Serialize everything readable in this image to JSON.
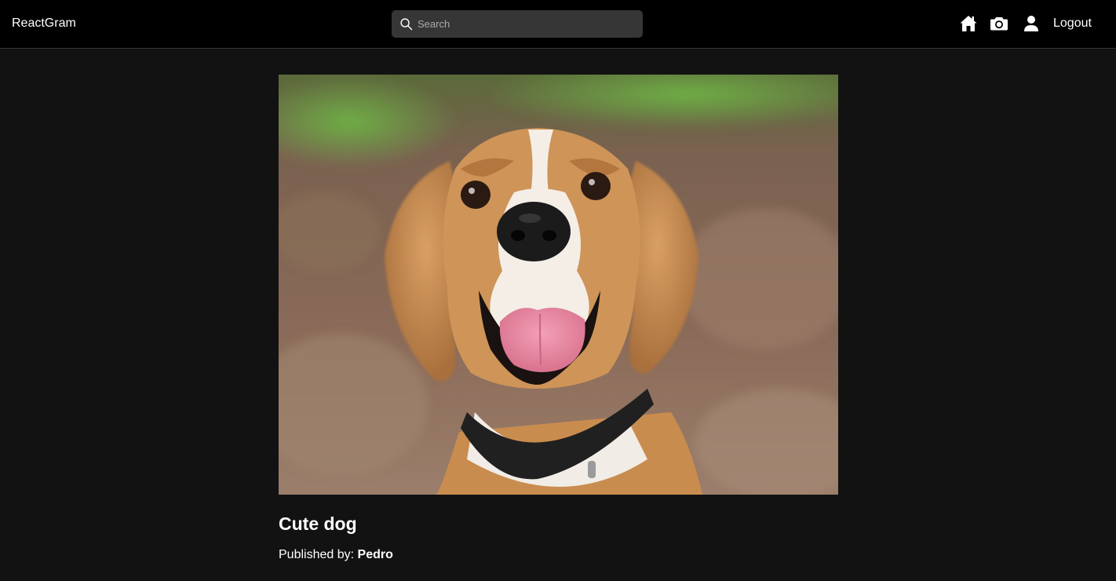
{
  "nav": {
    "brand": "ReactGram",
    "search": {
      "placeholder": "Search",
      "value": ""
    },
    "icons": [
      "home-icon",
      "camera-icon",
      "user-icon"
    ],
    "logout_label": "Logout"
  },
  "photo": {
    "image_description": "beagle-dog-photo",
    "title": "Cute dog",
    "published_label": "Published by:",
    "author": "Pedro"
  },
  "colors": {
    "background": "#121212",
    "navbar": "#000000",
    "search_bg": "#363636",
    "text": "#ffffff"
  }
}
